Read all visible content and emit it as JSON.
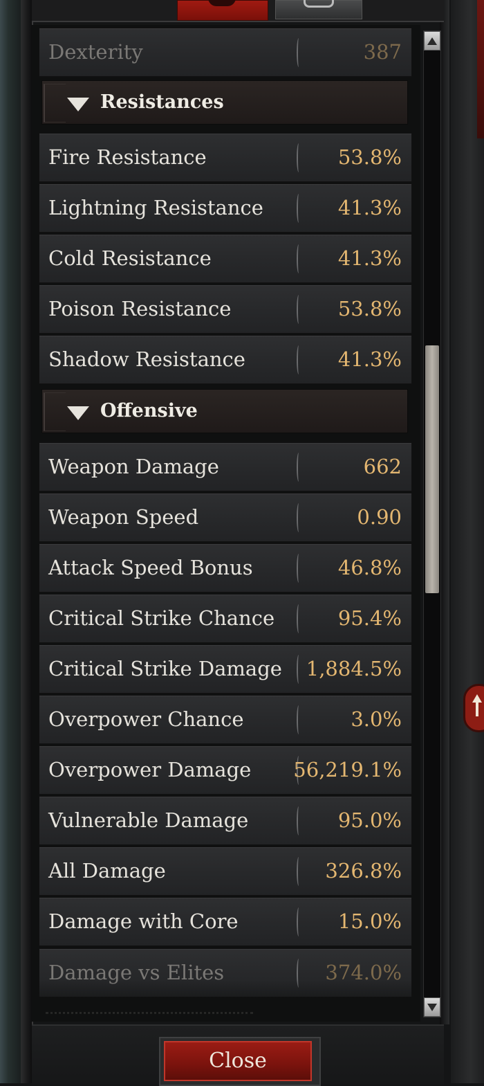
{
  "top_row": {
    "label": "Dexterity",
    "value": "387"
  },
  "sections": [
    {
      "title": "Resistances",
      "rows": [
        {
          "label": "Fire Resistance",
          "value": "53.8%"
        },
        {
          "label": "Lightning Resistance",
          "value": "41.3%"
        },
        {
          "label": "Cold Resistance",
          "value": "41.3%"
        },
        {
          "label": "Poison Resistance",
          "value": "53.8%"
        },
        {
          "label": "Shadow Resistance",
          "value": "41.3%"
        }
      ]
    },
    {
      "title": "Offensive",
      "rows": [
        {
          "label": "Weapon Damage",
          "value": "662"
        },
        {
          "label": "Weapon Speed",
          "value": "0.90"
        },
        {
          "label": "Attack Speed Bonus",
          "value": "46.8%"
        },
        {
          "label": "Critical Strike Chance",
          "value": "95.4%"
        },
        {
          "label": "Critical Strike Damage",
          "value": "1,884.5%"
        },
        {
          "label": "Overpower Chance",
          "value": "3.0%"
        },
        {
          "label": "Overpower Damage",
          "value": "56,219.1%"
        },
        {
          "label": "Vulnerable Damage",
          "value": "95.0%"
        },
        {
          "label": "All Damage",
          "value": "326.8%"
        },
        {
          "label": "Damage with Core",
          "value": "15.0%"
        },
        {
          "label": "Damage vs Elites",
          "value": "374.0%"
        }
      ]
    }
  ],
  "footer": {
    "close_label": "Close"
  },
  "icons": {
    "section_toggle": "triangle-down-icon",
    "scroll_up": "arrow-up-icon",
    "scroll_down": "arrow-down-icon",
    "side_widget": "arrow-up-icon"
  },
  "colors": {
    "value_text": "#e4b771",
    "label_text": "#e6e3dc",
    "accent_red": "#8d1d14"
  }
}
